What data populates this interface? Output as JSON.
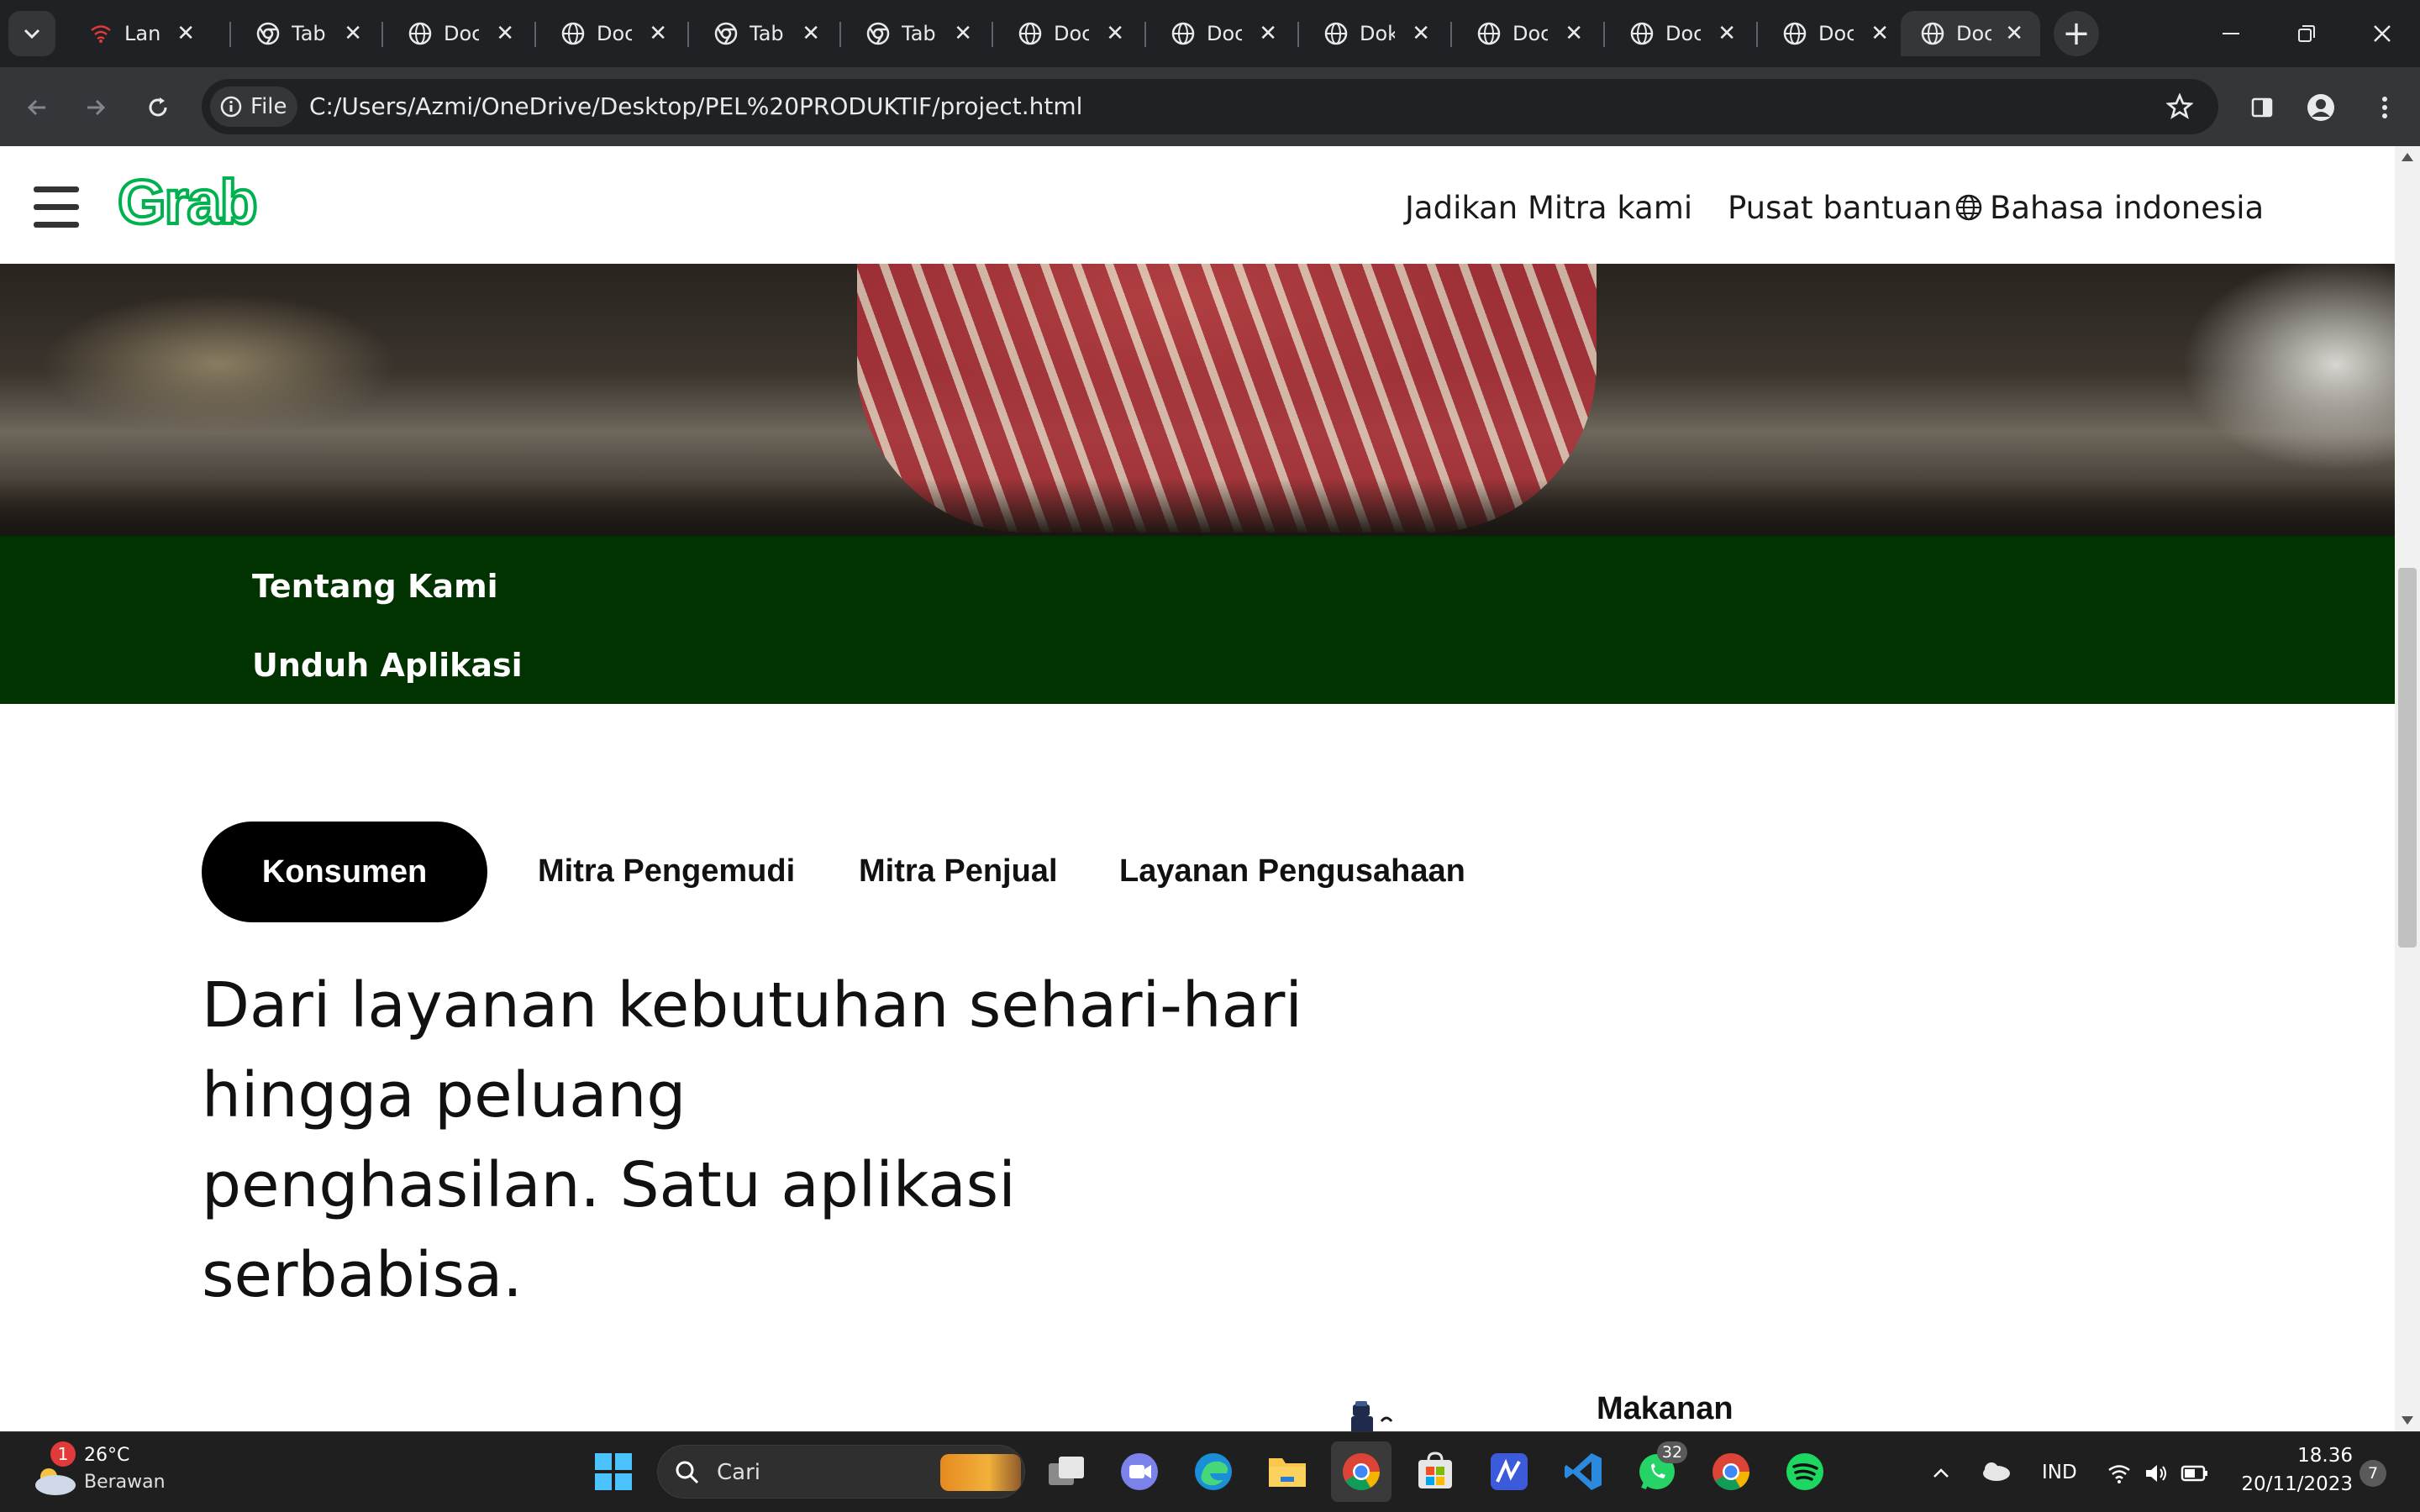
{
  "browser": {
    "tabs": [
      {
        "title": "Lan",
        "icon": "wifi-icon"
      },
      {
        "title": "Tab",
        "icon": "chrome-icon"
      },
      {
        "title": "Doc",
        "icon": "globe-icon"
      },
      {
        "title": "Doc",
        "icon": "globe-icon"
      },
      {
        "title": "Tab",
        "icon": "chrome-icon"
      },
      {
        "title": "Tab",
        "icon": "chrome-icon"
      },
      {
        "title": "Doc",
        "icon": "globe-icon"
      },
      {
        "title": "Doc",
        "icon": "globe-icon"
      },
      {
        "title": "Dok",
        "icon": "globe-icon"
      },
      {
        "title": "Doc",
        "icon": "globe-icon"
      },
      {
        "title": "Doc",
        "icon": "globe-icon"
      },
      {
        "title": "Doc",
        "icon": "globe-icon"
      },
      {
        "title": "Doc",
        "icon": "globe-icon"
      }
    ],
    "url_scheme_label": "File",
    "url": "C:/Users/Azmi/OneDrive/Desktop/PEL%20PRODUKTIF/project.html"
  },
  "site": {
    "logo": "Grab",
    "nav": {
      "partner": "Jadikan Mitra kami",
      "help": "Pusat bantuan",
      "language": "Bahasa indonesia"
    },
    "footer_links": [
      "Tentang Kami",
      "Unduh Aplikasi"
    ],
    "tabs": [
      "Konsumen",
      "Mitra Pengemudi",
      "Mitra Penjual",
      "Layanan Pengusahaan"
    ],
    "headline_lines": [
      "Dari layanan kebutuhan sehari-hari",
      "hingga peluang",
      "penghasilan. Satu aplikasi",
      "serbabisa."
    ],
    "service_label": "Makanan",
    "colors": {
      "brand_green": "#00b14f",
      "dark_green": "#003300",
      "pill_black": "#000000"
    }
  },
  "taskbar": {
    "weather_temp": "26°C",
    "weather_desc": "Berawan",
    "weather_badge": "1",
    "search_placeholder": "Cari",
    "whatsapp_badge": "32",
    "language": "IND",
    "time": "18.36",
    "date": "20/11/2023",
    "notification_count": "7"
  }
}
